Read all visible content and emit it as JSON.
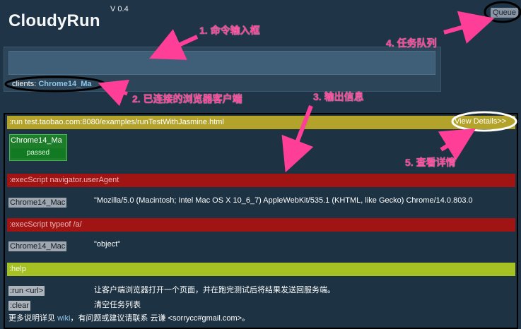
{
  "header": {
    "title": "CloudyRun",
    "version": "V 0.4",
    "queue_label": "Queue"
  },
  "command": {
    "placeholder": "",
    "value": ""
  },
  "clients": {
    "label": "clients:",
    "chip": "Chrome14_Ma"
  },
  "output": {
    "run_command": ":run test.taobao.com:8080/examples/runTestWithJasmine.html",
    "view_details": "View Details>>",
    "result_client": "Chrome14_Ma",
    "result_status": "passed",
    "exec1_command": ":execScript navigator.userAgent",
    "exec1_client": "Chrome14_Mac",
    "exec1_result": "\"Mozilla/5.0 (Macintosh; Intel Mac OS X 10_6_7) AppleWebKit/535.1 (KHTML, like Gecko) Chrome/14.0.803.0",
    "exec2_command": ":execScript typeof /a/",
    "exec2_client": "Chrome14_Mac",
    "exec2_result": "\"object\"",
    "help_command": ":help",
    "help_run_cmd": ":run <url>",
    "help_run_desc": "让客户端浏览器打开一个页面，并在跑完测试后将结果发送回服务端。",
    "help_clear_cmd": ":clear",
    "help_clear_desc": "清空任务列表",
    "help_footer_pre": "更多说明详见",
    "help_footer_link": "wiki",
    "help_footer_post": "，有问题或建议请联系 云谦 <sorrycc#gmail.com>。"
  },
  "annotations": {
    "a1": "1. 命令输入框",
    "a2": "2. 已连接的浏览器客户端",
    "a3": "3. 输出信息",
    "a4": "4. 任务队列",
    "a5": "5. 查看详情"
  },
  "colors": {
    "background": "#1f3547",
    "annotation": "#ff3e97",
    "bar_run": "#b3a32a",
    "bar_exec": "#a01414",
    "bar_help": "#a5c124",
    "passed": "#1e7d2b"
  }
}
